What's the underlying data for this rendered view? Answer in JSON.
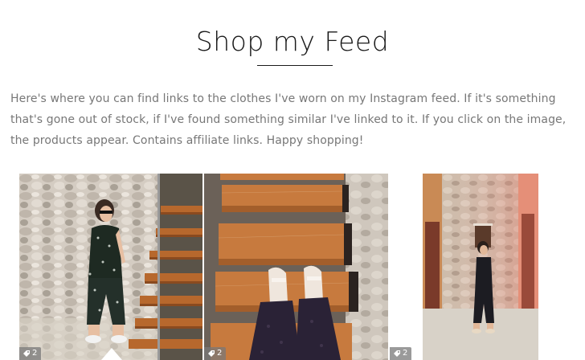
{
  "header": {
    "title": "Shop my Feed"
  },
  "intro": {
    "text": "Here's where you can find links to the clothes I've worn on my Instagram feed. If it's something that's gone out of stock, if I've found something similar I've linked to it. If you click on the image, the products appear. Contains affiliate links. Happy shopping!"
  },
  "feed": {
    "items": [
      {
        "tag_count": "2",
        "icon": "tag-icon"
      },
      {
        "tag_count": "2",
        "icon": "tag-icon"
      },
      {
        "tag_count": "2",
        "icon": "tag-icon"
      }
    ]
  },
  "colors": {
    "text": "#777777",
    "title": "#1a1a1a",
    "stone": "#cfc7bd",
    "wood": "#b8652d"
  }
}
